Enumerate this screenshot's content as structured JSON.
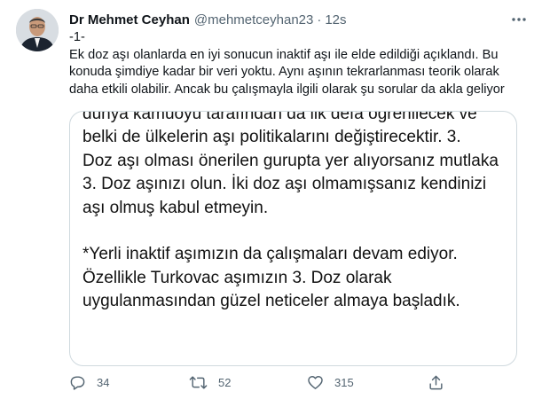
{
  "tweet": {
    "author_name": "Dr Mehmet Ceyhan",
    "handle": "@mehmetceyhan23",
    "separator": "·",
    "time": "12s",
    "text": "-1-\nEk doz aşı olanlarda en iyi sonucun inaktif aşı ile elde edildiği açıklandı. Bu konuda şimdiye kadar bir veri yoktu. Aynı aşının tekrarlanması teorik olarak daha etkili olabilir. Ancak bu çalışmayla ilgili olarak şu sorular da akla geliyor"
  },
  "media": {
    "lines": [
      "dünya kamuoyu tarafından da ilk defa öğrenilecek ve",
      "belki de ülkelerin aşı politikalarını değiştirecektir. 3.",
      "Doz aşı olması önerilen gurupta yer alıyorsanız mutlaka",
      "3. Doz aşınızı olun. İki doz aşı olmamışsanız kendinizi",
      "aşı olmuş kabul etmeyin.",
      "",
      "*Yerli inaktif aşımızın da çalışmaları devam ediyor.",
      "Özellikle Turkovac aşımızın 3. Doz olarak",
      "uygulanmasından güzel neticeler almaya başladık."
    ]
  },
  "actions": {
    "reply_count": "34",
    "retweet_count": "52",
    "like_count": "315",
    "icons": [
      "reply-icon",
      "retweet-icon",
      "like-icon",
      "share-icon"
    ],
    "icon_color": "#536471"
  }
}
